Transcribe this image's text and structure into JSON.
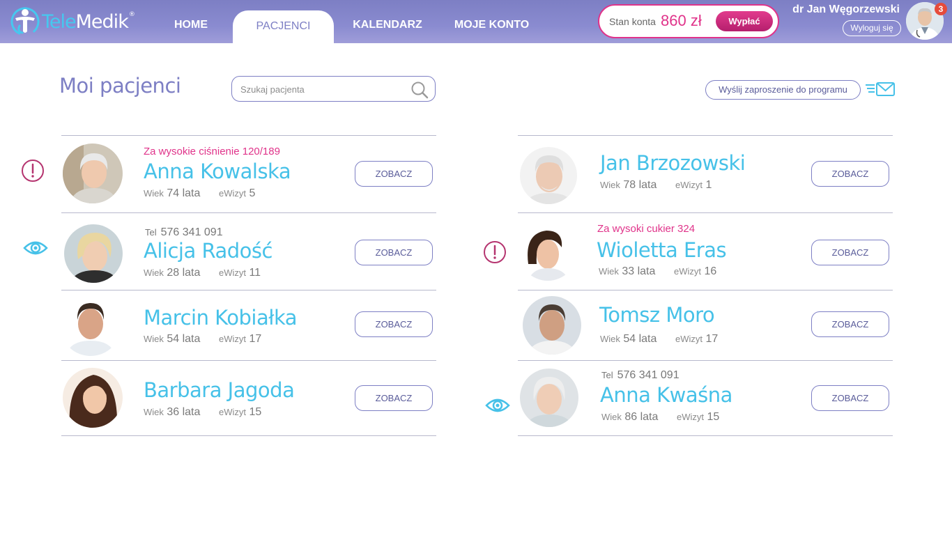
{
  "app": {
    "logo_part1": "Tele",
    "logo_part2": "Medik",
    "logo_reg": "®"
  },
  "nav": {
    "home": "HOME",
    "patients": "PACJENCI",
    "calendar": "KALENDARZ",
    "account": "MOJE KONTO"
  },
  "balance": {
    "label": "Stan konta",
    "value": "860 zł",
    "withdraw": "Wypłać"
  },
  "user": {
    "name": "dr Jan Węgorzewski",
    "logout": "Wyloguj się",
    "notifications": "3"
  },
  "page": {
    "title": "Moi pacjenci",
    "search_placeholder": "Szukaj pacjenta",
    "invite": "Wyślij zaproszenie do programu"
  },
  "labels": {
    "tel": "Tel",
    "age": "Wiek",
    "visits": "eWizyt",
    "view": "ZOBACZ"
  },
  "colors": {
    "brand": "#7d7fc4",
    "accent": "#46c1e8",
    "alert": "#e0338a"
  },
  "patients": [
    {
      "name": "Anna Kowalska",
      "alert": "Za wysokie ciśnienie 120/189",
      "tel": "",
      "age": "74 lata",
      "visits": "5",
      "status_icon": "alert-icon"
    },
    {
      "name": "Alicja Radość",
      "alert": "",
      "tel": "576 341 091",
      "age": "28 lata",
      "visits": "11",
      "status_icon": "eye-icon"
    },
    {
      "name": "Marcin Kobiałka",
      "alert": "",
      "tel": "",
      "age": "54 lata",
      "visits": "17",
      "status_icon": ""
    },
    {
      "name": "Barbara Jagoda",
      "alert": "",
      "tel": "",
      "age": "36 lata",
      "visits": "15",
      "status_icon": ""
    },
    {
      "name": "Jan Brzozowski",
      "alert": "",
      "tel": "",
      "age": "78 lata",
      "visits": "1",
      "status_icon": ""
    },
    {
      "name": "Wioletta Eras",
      "alert": "Za wysoki cukier 324",
      "tel": "",
      "age": "33 lata",
      "visits": "16",
      "status_icon": "alert-icon"
    },
    {
      "name": "Tomsz Moro",
      "alert": "",
      "tel": "",
      "age": "54 lata",
      "visits": "17",
      "status_icon": ""
    },
    {
      "name": "Anna Kwaśna",
      "alert": "",
      "tel": "576 341 091",
      "age": "86 lata",
      "visits": "15",
      "status_icon": "eye-icon"
    }
  ]
}
